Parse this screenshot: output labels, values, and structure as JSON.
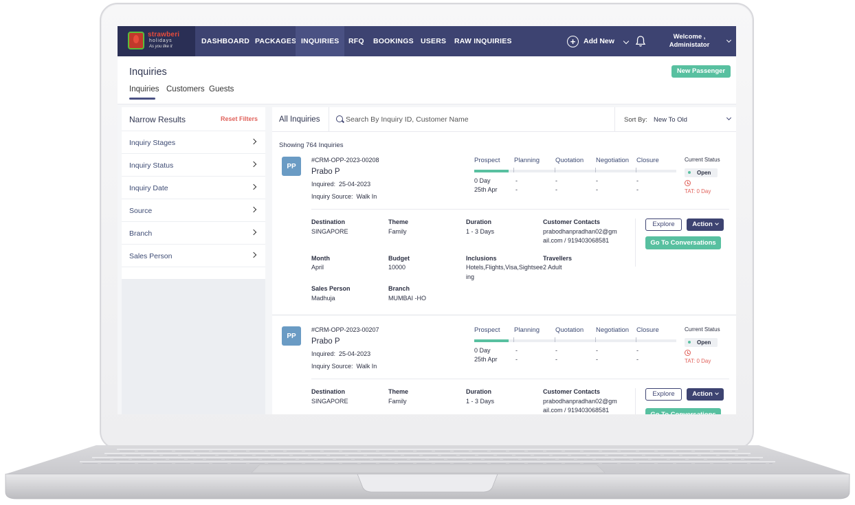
{
  "brand": {
    "name": "strawberi",
    "sub": "holidays",
    "tagline": "As you like it"
  },
  "nav": {
    "items": [
      "DASHBOARD",
      "PACKAGES",
      "INQUIRIES",
      "RFQ",
      "BOOKINGS",
      "USERS",
      "RAW INQUIRIES"
    ],
    "active": "INQUIRIES",
    "add_new": "Add New",
    "welcome_line1": "Welcome ,",
    "welcome_line2": "Administator"
  },
  "header": {
    "title": "Inquiries",
    "tabs": [
      "Inquiries",
      "Customers",
      "Guests"
    ],
    "new_passenger": "New Passenger"
  },
  "filters": {
    "title": "Narrow Results",
    "reset": "Reset Filters",
    "items": [
      "Inquiry Stages",
      "Inquiry Status",
      "Inquiry Date",
      "Source",
      "Branch",
      "Sales Person"
    ]
  },
  "search": {
    "tab": "All Inquiries",
    "placeholder": "Search By Inquiry ID, Customer Name",
    "sort_label": "Sort By:",
    "sort_value": "New To Old"
  },
  "showing": "Showing 764 Inquiries",
  "labels": {
    "inquired": "Inquired:",
    "inquiry_source": "Inquiry Source:",
    "stages": [
      "Prospect",
      "Planning",
      "Quotation",
      "Negotiation",
      "Closure"
    ],
    "current_status": "Current Status",
    "destination": "Destination",
    "theme": "Theme",
    "duration": "Duration",
    "customer_contacts": "Customer Contacts",
    "month": "Month",
    "budget": "Budget",
    "inclusions": "Inclusions",
    "travellers": "Travellers",
    "sales_person": "Sales Person",
    "branch": "Branch",
    "explore": "Explore",
    "action": "Action",
    "go_conv": "Go To Conversations"
  },
  "inquiries": [
    {
      "initials": "PP",
      "id": "#CRM-OPP-2023-00208",
      "name": "Prabo P",
      "inquired": "25-04-2023",
      "source": "Walk In",
      "progress": 0.17,
      "stage_days": [
        "0 Day",
        "-",
        "-",
        "-",
        "-"
      ],
      "stage_date": "25th Apr",
      "stage_dashes": [
        "-",
        "-",
        "-",
        "-"
      ],
      "status": "Open",
      "tat": "TAT: 0 Day",
      "destination": "SINGAPORE",
      "theme": "Family",
      "duration": "1 - 3 Days",
      "contacts_1": "prabodhanpradhan02@gm",
      "contacts_2": "ail.com / 919403068581",
      "month": "April",
      "budget": "10000",
      "inclusions_1": "Hotels,Flights,Visa,Sightsee",
      "inclusions_2": "ing",
      "travellers": "2 Adult",
      "sales_person": "Madhuja",
      "branch": "MUMBAI -HO"
    },
    {
      "initials": "PP",
      "id": "#CRM-OPP-2023-00207",
      "name": "Prabo P",
      "inquired": "25-04-2023",
      "source": "Walk In",
      "progress": 0.17,
      "stage_days": [
        "0 Day",
        "-",
        "-",
        "-",
        "-"
      ],
      "stage_date": "25th Apr",
      "stage_dashes": [
        "-",
        "-",
        "-",
        "-"
      ],
      "status": "Open",
      "tat": "TAT: 0 Day",
      "destination": "SINGAPORE",
      "theme": "Family",
      "duration": "1 - 3 Days",
      "contacts_1": "prabodhanpradhan02@gm",
      "contacts_2": "ail.com / 919403068581"
    }
  ]
}
